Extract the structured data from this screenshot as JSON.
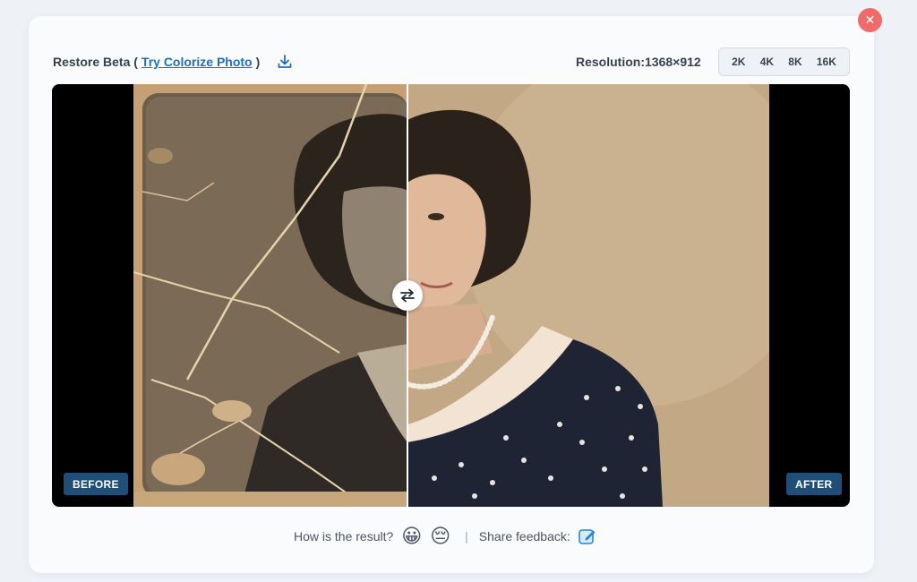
{
  "toolbar": {
    "restore_label": "Restore Beta (",
    "colorize_link": "Try Colorize Photo",
    "close_paren": ")",
    "resolution_label": "Resolution:1368×912",
    "resolution_options": [
      "2K",
      "4K",
      "8K",
      "16K"
    ]
  },
  "viewer": {
    "before_label": "BEFORE",
    "after_label": "AFTER"
  },
  "feedback": {
    "question": "How is the result?",
    "happy_emoji": "😀",
    "sad_emoji": "😔",
    "separator": "|",
    "share_label": "Share feedback:"
  },
  "close_glyph": "✕",
  "icons": [
    "close-icon",
    "download-icon",
    "swap-icon",
    "edit-feedback-icon"
  ],
  "colors": {
    "close": "#f06a6a",
    "link": "#1d6fc0",
    "badge": "#1f4f79"
  }
}
